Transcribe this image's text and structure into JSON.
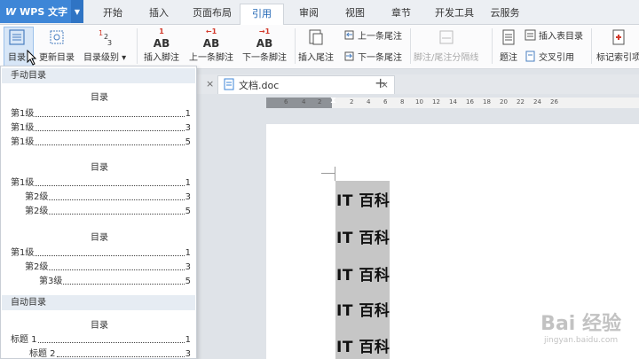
{
  "app": {
    "name": "WPS 文字"
  },
  "tabs": [
    "开始",
    "插入",
    "页面布局",
    "引用",
    "审阅",
    "视图",
    "章节",
    "开发工具",
    "云服务"
  ],
  "ribbon": {
    "toc": "目录",
    "update_toc": "更新目录",
    "toc_level": "目录级别",
    "insert_footnote": "插入脚注",
    "prev_footnote": "上一条脚注",
    "next_footnote": "下一条脚注",
    "insert_endnote": "插入尾注",
    "prev_endnote": "上一条尾注",
    "next_endnote": "下一条尾注",
    "separator_line": "脚注/尾注分隔线",
    "caption": "题注",
    "insert_table_of_figures": "插入表目录",
    "cross_reference": "交叉引用",
    "mark_index": "标记索引项"
  },
  "document": {
    "tab_name": "文档.doc",
    "lines": [
      "IT 百科",
      "IT 百科",
      "IT 百科",
      "IT 百科",
      "IT 百科"
    ]
  },
  "ruler": {
    "ticks": [
      "6",
      "4",
      "2",
      "2",
      "4",
      "6",
      "8",
      "10",
      "12",
      "14",
      "16",
      "18",
      "20",
      "22",
      "24",
      "26"
    ]
  },
  "toc_gallery": {
    "manual_header": "手动目录",
    "auto_header": "自动目录",
    "title": "目录",
    "level1": "第1级",
    "level2": "第2级",
    "level3": "第3级",
    "heading1": "标题 1",
    "heading2": "标题 2",
    "page_1": "1",
    "page_3": "3",
    "page_5": "5"
  },
  "watermark": {
    "brand": "Bai 经验",
    "url": "jingyan.baidu.com"
  },
  "colors": {
    "accent": "#3e86d7",
    "selection": "#c6c6c6",
    "highlight": "#d7e6f7"
  }
}
